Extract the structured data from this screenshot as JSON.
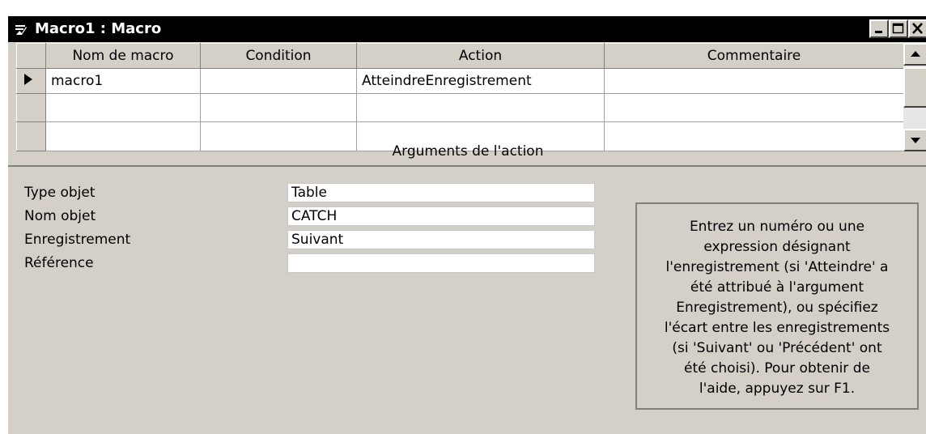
{
  "window": {
    "title": "Macro1 : Macro",
    "controls": {
      "minimize_icon": "minimize-icon",
      "maximize_icon": "maximize-icon",
      "close_icon": "close-icon"
    }
  },
  "grid": {
    "headers": {
      "name": "Nom de macro",
      "condition": "Condition",
      "action": "Action",
      "comment": "Commentaire"
    },
    "rows": [
      {
        "name": "macro1",
        "condition": "",
        "action": "AtteindreEnregistrement",
        "comment": ""
      },
      {
        "name": "",
        "condition": "",
        "action": "",
        "comment": ""
      },
      {
        "name": "",
        "condition": "",
        "action": "",
        "comment": ""
      }
    ]
  },
  "arguments": {
    "title": "Arguments de l'action",
    "fields": [
      {
        "label": "Type objet",
        "value": "Table"
      },
      {
        "label": "Nom objet",
        "value": "CATCH"
      },
      {
        "label": "Enregistrement",
        "value": "Suivant"
      },
      {
        "label": "Référence",
        "value": ""
      }
    ],
    "help_lines": [
      "Entrez un numéro ou une",
      "expression désignant",
      "l'enregistrement (si 'Atteindre' a",
      "été attribué à l'argument",
      "Enregistrement), ou spécifiez",
      "l'écart entre les enregistrements",
      "(si 'Suivant' ou 'Précédent' ont",
      "été choisi). Pour obtenir de",
      "l'aide, appuyez sur F1."
    ]
  },
  "colors": {
    "titlebar": "#000000",
    "face": "#d4d0c8",
    "window_bg": "#ffffff"
  }
}
